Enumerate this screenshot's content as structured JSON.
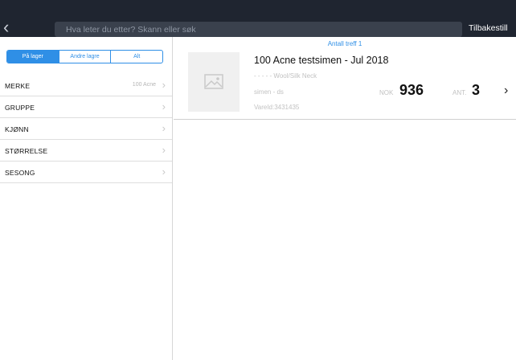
{
  "header": {
    "search_placeholder": "Hva leter du etter? Skann eller søk",
    "reset_label": "Tilbakestill"
  },
  "segments": [
    {
      "label": "På lager",
      "active": true
    },
    {
      "label": "Andre lagre",
      "active": false
    },
    {
      "label": "Alt",
      "active": false
    }
  ],
  "filters": [
    {
      "label": "MERKE",
      "value": "100 Acne"
    },
    {
      "label": "GRUPPE",
      "value": ""
    },
    {
      "label": "KJØNN",
      "value": ""
    },
    {
      "label": "STØRRELSE",
      "value": ""
    },
    {
      "label": "SESONG",
      "value": ""
    }
  ],
  "results": {
    "hit_count_text": "Antall treff 1",
    "items": [
      {
        "name": "100 Acne testsimen - Jul 2018",
        "description": "- - - -  - Wool/Silk Neck",
        "brand_line": "simen - ds",
        "item_id": "VareId:3431435",
        "price_label": "NOK",
        "price": "936",
        "qty_label": "ANT.",
        "qty": "3"
      }
    ]
  },
  "colors": {
    "topbar": "#1f2530",
    "accent": "#2f8fe6"
  }
}
